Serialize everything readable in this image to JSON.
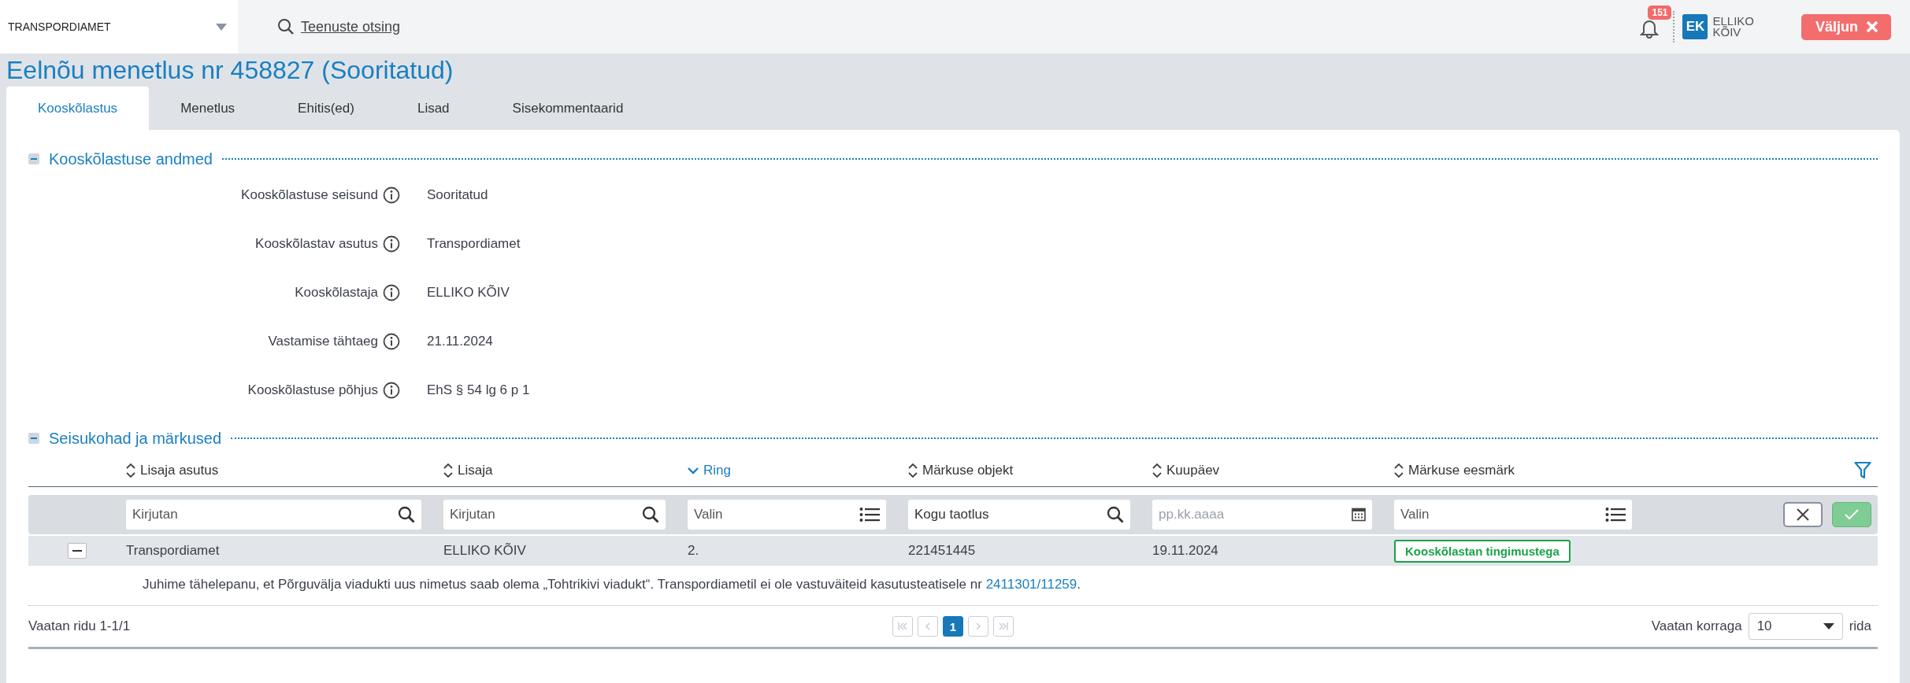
{
  "top_bar": {
    "organization_select": {
      "value": "TRANSPORDIAMET"
    },
    "service_search": {
      "label": "Teenuste otsing"
    },
    "notifications": {
      "count": "151"
    },
    "user": {
      "initials": "EK",
      "name_lines": [
        "ELLIKO",
        "KÕIV"
      ]
    },
    "logout_button": {
      "label": "Väljun"
    }
  },
  "page_title": "Eelnõu menetlus nr 458827 (Sooritatud)",
  "tabs": [
    {
      "label": "Kooskõlastus",
      "selected": true
    },
    {
      "label": "Menetlus",
      "selected": false
    },
    {
      "label": "Ehitis(ed)",
      "selected": false
    },
    {
      "label": "Lisad",
      "selected": false
    },
    {
      "label": "Sisekommentaarid",
      "selected": false
    }
  ],
  "details_section": {
    "title": "Kooskõlastuse andmed",
    "expanded": true,
    "fields": [
      {
        "label": "Kooskõlastuse seisund",
        "value": "Sooritatud"
      },
      {
        "label": "Kooskõlastav asutus",
        "value": "Transpordiamet"
      },
      {
        "label": "Kooskõlastaja",
        "value": "ELLIKO KÕIV"
      },
      {
        "label": "Vastamise tähtaeg",
        "value": "21.11.2024"
      },
      {
        "label": "Kooskõlastuse põhjus",
        "value": "EhS § 54 lg 6 p 1"
      }
    ]
  },
  "remarks_section": {
    "title": "Seisukohad ja märkused",
    "expanded": true,
    "columns": [
      {
        "label": "Lisaja asutus",
        "sorted": false
      },
      {
        "label": "Lisaja",
        "sorted": false
      },
      {
        "label": "Ring",
        "sorted": true
      },
      {
        "label": "Märkuse objekt",
        "sorted": false
      },
      {
        "label": "Kuupäev",
        "sorted": false
      },
      {
        "label": "Märkuse eesmärk",
        "sorted": false
      }
    ],
    "filters": [
      {
        "kind": "text",
        "placeholder": "Kirjutan"
      },
      {
        "kind": "text",
        "placeholder": "Kirjutan"
      },
      {
        "kind": "list",
        "placeholder": "Valin"
      },
      {
        "kind": "text",
        "value": "Kogu taotlus"
      },
      {
        "kind": "date",
        "placeholder": "pp.kk.aaaa"
      },
      {
        "kind": "list",
        "placeholder": "Valin"
      }
    ],
    "rows": [
      {
        "expanded": true,
        "cells": [
          "Transpordiamet",
          "ELLIKO KÕIV",
          "2.",
          "221451445",
          "19.11.2024"
        ],
        "purpose": {
          "label": "Kooskõlastan tingimustega",
          "color": "#1aa34a"
        },
        "comment": {
          "text": "Juhime tähelepanu, et Põrguvälja viadukti uus nimetus saab olema „Tohtrikivi viadukt“. Transpordiametil ei ole vastuväiteid kasutusteatisele nr ",
          "link": "2411301/11259",
          "after": "."
        }
      }
    ],
    "footer": {
      "range": "Vaatan ridu 1-1/1",
      "pages": [
        {
          "kind": "first",
          "disabled": true
        },
        {
          "kind": "prev",
          "disabled": true
        },
        {
          "kind": "page",
          "label": "1",
          "selected": true
        },
        {
          "kind": "next",
          "disabled": true
        },
        {
          "kind": "last",
          "disabled": true
        }
      ],
      "page_size_label": "Vaatan korraga",
      "page_size": "10",
      "page_size_suffix": "rida"
    }
  }
}
